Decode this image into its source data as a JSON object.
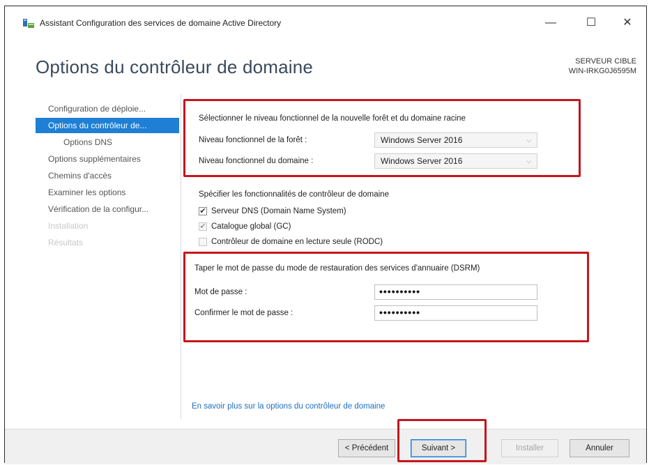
{
  "window": {
    "title": "Assistant Configuration des services de domaine Active Directory",
    "controls": {
      "minimize": "—",
      "maximize": "☐",
      "close": "✕"
    }
  },
  "header": {
    "page_title": "Options du contrôleur de domaine",
    "target_heading": "SERVEUR CIBLE",
    "target_server": "WIN-IRKG0J6595M"
  },
  "sidebar": {
    "items": [
      {
        "label": "Configuration de déploie..."
      },
      {
        "label": "Options du contrôleur de..."
      },
      {
        "label": "Options DNS"
      },
      {
        "label": "Options supplémentaires"
      },
      {
        "label": "Chemins d'accès"
      },
      {
        "label": "Examiner les options"
      },
      {
        "label": "Vérification de la configur..."
      },
      {
        "label": "Installation"
      },
      {
        "label": "Résultats"
      }
    ]
  },
  "functional_level": {
    "heading": "Sélectionner le niveau fonctionnel de la nouvelle forêt et du domaine racine",
    "forest_label": "Niveau fonctionnel de la forêt :",
    "forest_value": "Windows Server 2016",
    "domain_label": "Niveau fonctionnel du domaine :",
    "domain_value": "Windows Server 2016"
  },
  "capabilities": {
    "heading": "Spécifier les fonctionnalités de contrôleur de domaine",
    "dns_label": "Serveur DNS (Domain Name System)",
    "gc_label": "Catalogue global (GC)",
    "rodc_label": "Contrôleur de domaine en lecture seule (RODC)",
    "check_glyph": "✔"
  },
  "dsrm": {
    "heading": "Taper le mot de passe du mode de restauration des services d'annuaire (DSRM)",
    "password_label": "Mot de passe :",
    "password_value": "••••••••••",
    "confirm_label": "Confirmer le mot de passe :",
    "confirm_value": "••••••••••"
  },
  "link": {
    "text": "En savoir plus sur la options du contrôleur de domaine"
  },
  "footer": {
    "previous": "< Précédent",
    "next": "Suivant >",
    "install": "Installer",
    "cancel": "Annuler"
  },
  "colors": {
    "highlight": "#c4161c",
    "nav_active": "#1e7fd4",
    "link": "#1e6fbf",
    "title": "#3a4a5c"
  },
  "icons": [
    "ad-ds-wizard-icon",
    "checkmark-icon",
    "chevron-down-icon"
  ]
}
